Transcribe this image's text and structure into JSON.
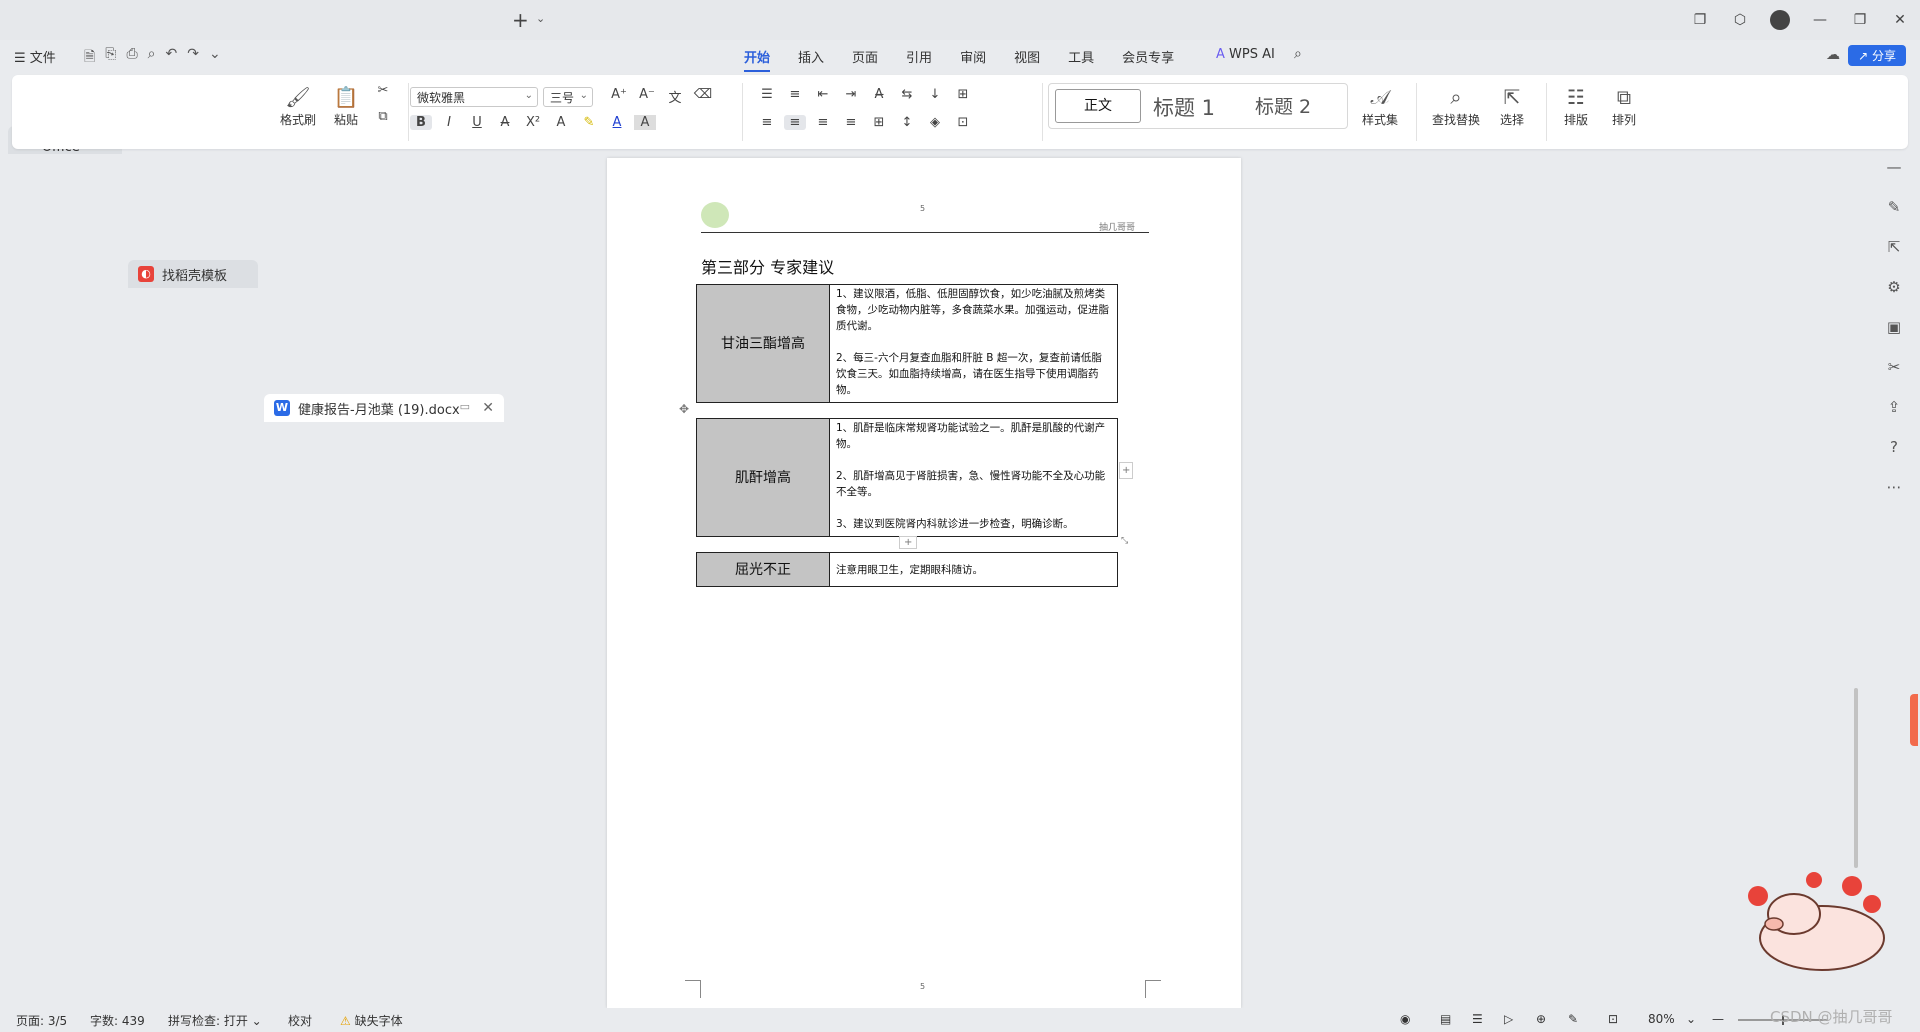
{
  "tabs": [
    {
      "label": "WPS Office",
      "icon": "wps-logo-icon",
      "color": "#e0312e"
    },
    {
      "label": "找稻壳模板",
      "icon": "docer-icon",
      "color": "#e8433a"
    },
    {
      "label": "健康报告-月池葉 (19).docx",
      "icon": "word-doc-icon",
      "color": "#2b6be6"
    }
  ],
  "menu": {
    "file": "☰ 文件",
    "tabs": [
      "开始",
      "插入",
      "页面",
      "引用",
      "审阅",
      "视图",
      "工具",
      "会员专享"
    ],
    "active_tab": "开始",
    "wps_ai": "WPS AI",
    "share": "分享"
  },
  "ribbon": {
    "format_painter": "格式刷",
    "paste": "粘贴",
    "font_name": "微软雅黑",
    "font_size": "三号",
    "style_current": "正文",
    "style_h1": "标题 1",
    "style_h2": "标题 2",
    "style_set": "样式集",
    "find_replace": "查找替换",
    "select": "选择",
    "layout": "排版",
    "arrange": "排列"
  },
  "document": {
    "header_page_number": "5",
    "header_right_text": "抽几哥哥",
    "section_title": "第三部分  专家建议",
    "tables": [
      {
        "label": "甘油三酯增高",
        "lines": [
          "1、建议限酒，低脂、低胆固醇饮食，如少吃油腻及煎烤类食物，少吃动物内脏等，多食蔬菜水果。加强运动，促进脂质代谢。",
          "",
          "2、每三-六个月复查血脂和肝脏 B 超一次，复查前请低脂饮食三天。如血脂持续增高，请在医生指导下使用调脂药物。"
        ]
      },
      {
        "label": "肌酐增高",
        "lines": [
          "1、肌酐是临床常规肾功能试验之一。肌酐是肌酸的代谢产物。",
          "",
          "2、肌酐增高见于肾脏损害，急、慢性肾功能不全及心功能不全等。",
          "",
          "3、建议到医院肾内科就诊进一步检查，明确诊断。"
        ]
      },
      {
        "label": "屈光不正",
        "lines": [
          "注意用眼卫生，定期眼科随访。"
        ]
      }
    ],
    "footer_page_number": "5"
  },
  "status": {
    "page": "页面: 3/5",
    "words": "字数: 439",
    "spellcheck": "拼写检查: 打开",
    "proofread": "校对",
    "missing_font": "缺失字体",
    "zoom": "80%"
  },
  "watermark": "CSDN @抽几哥哥"
}
